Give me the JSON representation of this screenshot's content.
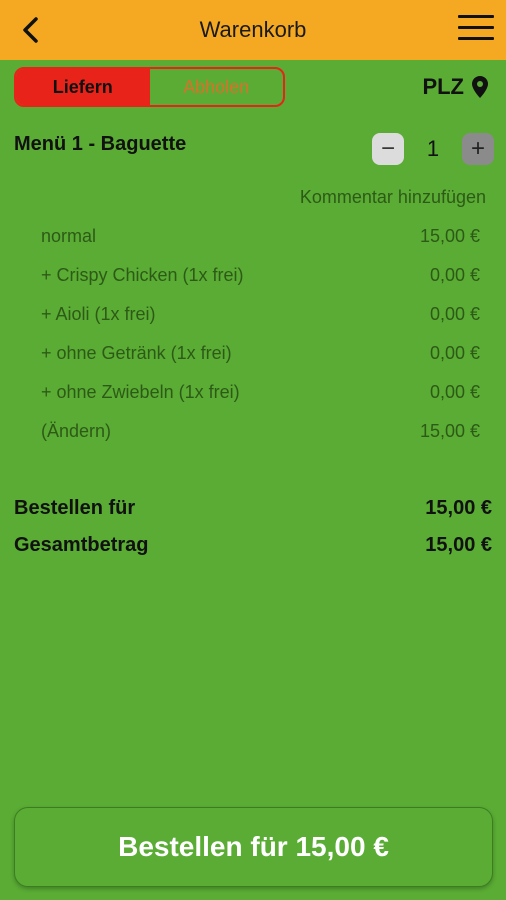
{
  "header": {
    "title": "Warenkorb",
    "back_icon": "chevron-left-icon",
    "menu_icon": "hamburger-menu-icon"
  },
  "delivery_toggle": {
    "deliver_label": "Liefern",
    "pickup_label": "Abholen",
    "selected": "Liefern"
  },
  "location": {
    "label": "PLZ",
    "icon": "map-pin-icon"
  },
  "cart_item": {
    "name": "Menü 1 - Baguette",
    "quantity": "1",
    "minus_label": "−",
    "plus_label": "+",
    "comment_link": "Kommentar hinzufügen",
    "options": [
      {
        "label": "normal",
        "price": "15,00 €"
      },
      {
        "label": "+ Crispy Chicken (1x frei)",
        "price": "0,00 €"
      },
      {
        "label": "+ Aioli (1x frei)",
        "price": "0,00 €"
      },
      {
        "label": "+ ohne Getränk (1x frei)",
        "price": "0,00 €"
      },
      {
        "label": "+ ohne Zwiebeln (1x frei)",
        "price": "0,00 €"
      },
      {
        "label": "(Ändern)",
        "price": "15,00 €"
      }
    ]
  },
  "summary": {
    "order_for_label": "Bestellen für",
    "order_for_value": "15,00 €",
    "total_label": "Gesamtbetrag",
    "total_value": "15,00 €"
  },
  "order_button": {
    "label": "Bestellen für 15,00 €"
  },
  "colors": {
    "background": "#5aac34",
    "header": "#f5a922",
    "accent_red": "#e8231a"
  }
}
